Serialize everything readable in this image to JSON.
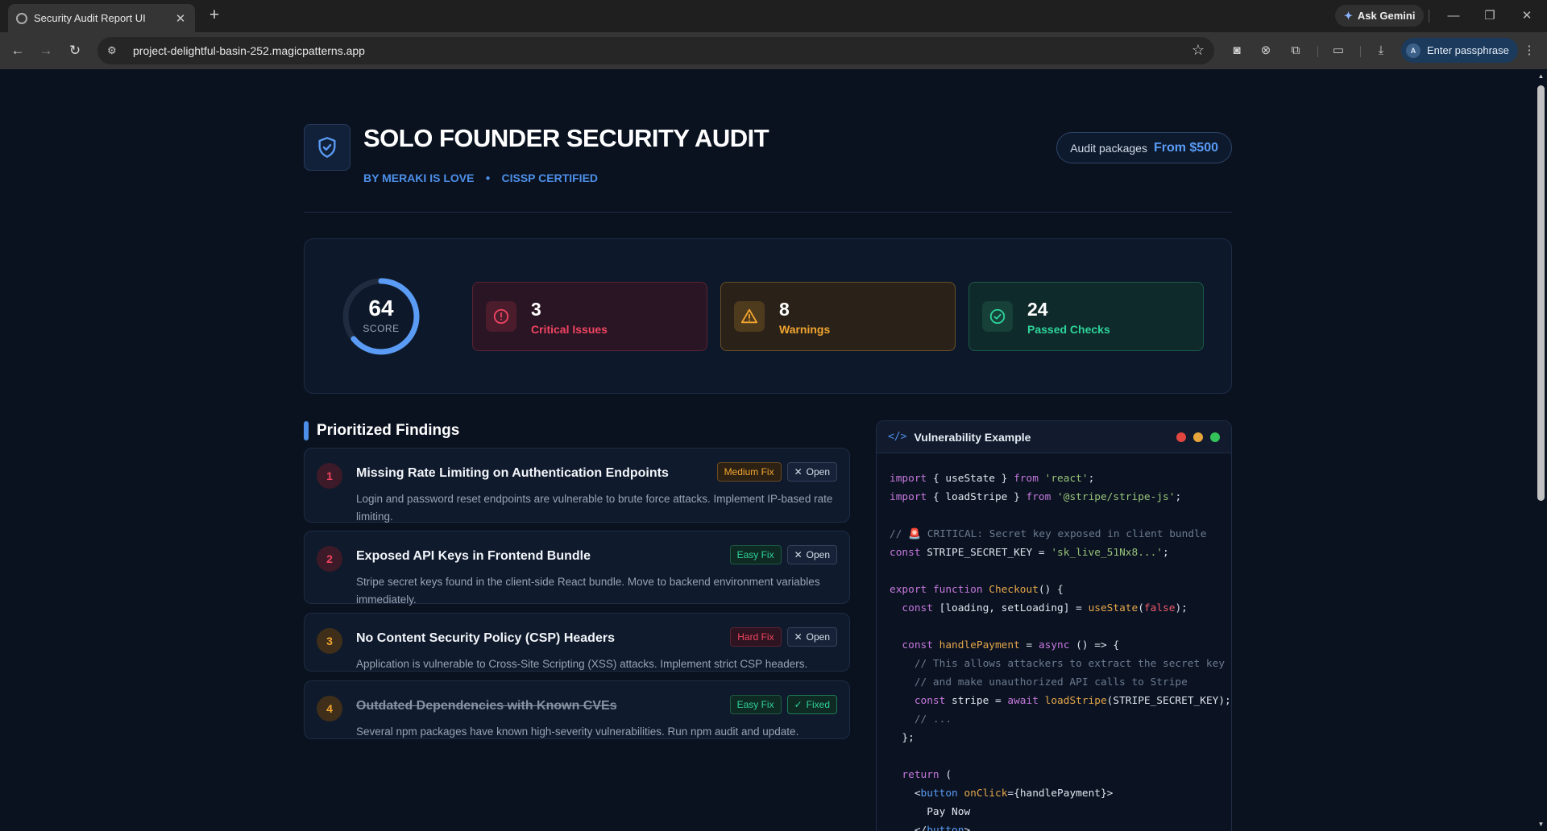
{
  "browser": {
    "tab_title": "Security Audit Report UI",
    "url": "project-delightful-basin-252.magicpatterns.app",
    "gemini_label": "Ask Gemini",
    "profile_initial": "A",
    "profile_label": "Enter passphrase"
  },
  "header": {
    "title": "SOLO FOUNDER SECURITY AUDIT",
    "author": "BY MERAKI IS LOVE",
    "certification": "CISSP CERTIFIED",
    "packages_label": "Audit packages",
    "packages_price": "From $500"
  },
  "score": {
    "value": "64",
    "label": "SCORE",
    "fraction": 0.64,
    "color": "#5a9cf5"
  },
  "stats": [
    {
      "count": "3",
      "label": "Critical Issues",
      "color": "#ef4461"
    },
    {
      "count": "8",
      "label": "Warnings",
      "color": "#f2a530"
    },
    {
      "count": "24",
      "label": "Passed Checks",
      "color": "#2ed39a"
    }
  ],
  "findings_title": "Prioritized Findings",
  "findings": [
    {
      "num": "1",
      "title": "Missing Rate Limiting on Authentication Endpoints",
      "description": "Login and password reset endpoints are vulnerable to brute force attacks. Implement IP-based rate limiting.",
      "difficulty": "Medium Fix",
      "status": "Open"
    },
    {
      "num": "2",
      "title": "Exposed API Keys in Frontend Bundle",
      "description": "Stripe secret keys found in the client-side React bundle. Move to backend environment variables immediately.",
      "difficulty": "Easy Fix",
      "status": "Open"
    },
    {
      "num": "3",
      "title": "No Content Security Policy (CSP) Headers",
      "description": "Application is vulnerable to Cross-Site Scripting (XSS) attacks. Implement strict CSP headers.",
      "difficulty": "Hard Fix",
      "status": "Open"
    },
    {
      "num": "4",
      "title": "Outdated Dependencies with Known CVEs",
      "description": "Several npm packages have known high-severity vulnerabilities. Run npm audit and update.",
      "difficulty": "Easy Fix",
      "status": "Fixed"
    }
  ],
  "code_panel": {
    "title": "Vulnerability Example",
    "dot_colors": [
      "#e0453f",
      "#e6a43a",
      "#34c25a"
    ],
    "lines": {
      "l1_kw": "import",
      "l1_mid": " { useState } ",
      "l1_from": "from",
      "l1_str": " 'react'",
      "l1_end": ";",
      "l2_kw": "import",
      "l2_mid": " { loadStripe } ",
      "l2_from": "from",
      "l2_str": " '@stripe/stripe-js'",
      "l2_end": ";",
      "l3_cm": "// 🚨 CRITICAL: Secret key exposed in client bundle",
      "l4_kw": "const",
      "l4_mid": " STRIPE_SECRET_KEY = ",
      "l4_str": "'sk_live_51Nx8...'",
      "l4_end": ";",
      "l5_kw1": "export",
      "l5_kw2": " function",
      "l5_fn": " Checkout",
      "l5_end": "() {",
      "l6_kw": "  const",
      "l6_mid": " [loading, setLoading] = ",
      "l6_fn": "useState",
      "l6_p1": "(",
      "l6_bool": "false",
      "l6_end": ");",
      "l7_kw": "  const",
      "l7_fn": " handlePayment",
      "l7_mid": " = ",
      "l7_kw2": "async",
      "l7_end": " () => {",
      "l8_cm": "    // This allows attackers to extract the secret key",
      "l9_cm": "    // and make unauthorized API calls to Stripe",
      "l10_kw": "    const",
      "l10_mid": " stripe = ",
      "l10_kw2": "await",
      "l10_fn": " loadStripe",
      "l10_end": "(STRIPE_SECRET_KEY);",
      "l11_cm": "    // ...",
      "l12": "  };",
      "l13_kw": "  return",
      "l13_end": " (",
      "l14_lt": "    <",
      "l14_tag": "button",
      "l14_attr": " onClick",
      "l14_end": "={handlePayment}>",
      "l15": "      Pay Now",
      "l16_lt": "    </",
      "l16_tag": "button",
      "l16_end": ">"
    }
  }
}
